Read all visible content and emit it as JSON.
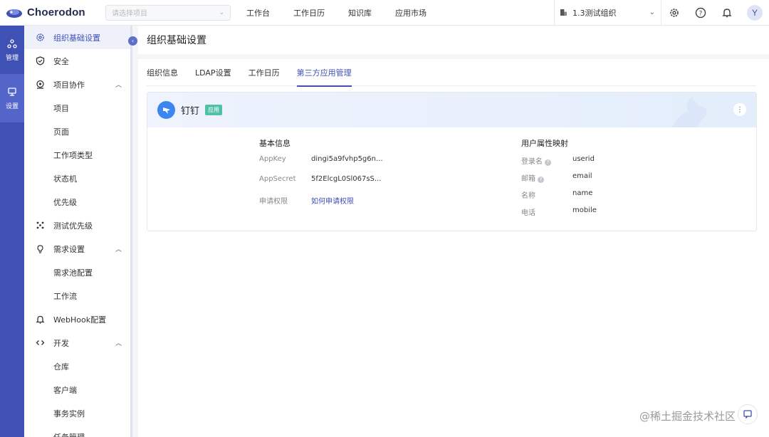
{
  "header": {
    "logo_text": "Choerodon",
    "project_select_placeholder": "请选择项目",
    "nav": [
      "工作台",
      "工作日历",
      "知识库",
      "应用市场"
    ],
    "org_select": "1.3测试组织",
    "avatar_letter": "Y"
  },
  "rail": {
    "items": [
      {
        "label": "管理"
      },
      {
        "label": "设置"
      }
    ]
  },
  "sidebar": {
    "items": [
      {
        "label": "组织基础设置",
        "icon": "gear-icon",
        "active": true
      },
      {
        "label": "安全",
        "icon": "shield-icon"
      },
      {
        "label": "项目协作",
        "icon": "collab-icon",
        "expanded": true
      },
      {
        "label": "项目",
        "sub": true
      },
      {
        "label": "页面",
        "sub": true
      },
      {
        "label": "工作项类型",
        "sub": true
      },
      {
        "label": "状态机",
        "sub": true
      },
      {
        "label": "优先级",
        "sub": true
      },
      {
        "label": "测试优先级",
        "icon": "grid-icon"
      },
      {
        "label": "需求设置",
        "icon": "bulb-icon",
        "expanded": true
      },
      {
        "label": "需求池配置",
        "sub": true
      },
      {
        "label": "工作流",
        "sub": true
      },
      {
        "label": "WebHook配置",
        "icon": "bell-icon"
      },
      {
        "label": "开发",
        "icon": "code-icon",
        "expanded": true
      },
      {
        "label": "仓库",
        "sub": true
      },
      {
        "label": "客户端",
        "sub": true
      },
      {
        "label": "事务实例",
        "sub": true
      },
      {
        "label": "任务管理",
        "sub": true
      }
    ]
  },
  "page": {
    "title": "组织基础设置",
    "tabs": [
      {
        "label": "组织信息"
      },
      {
        "label": "LDAP设置"
      },
      {
        "label": "工作日历"
      },
      {
        "label": "第三方应用管理",
        "active": true
      }
    ]
  },
  "app_card": {
    "name": "钉钉",
    "status": "应用",
    "basic_title": "基本信息",
    "basic": [
      {
        "label": "AppKey",
        "value": "dingi5a9fvhp5g6n..."
      },
      {
        "label": "AppSecret",
        "value": "5f2ElcgL0Sl067sS..."
      },
      {
        "label": "申请权限",
        "value": "如何申请权限",
        "link": true
      }
    ],
    "mapping_title": "用户属性映射",
    "mapping": [
      {
        "label": "登录名",
        "value": "userid",
        "help": true
      },
      {
        "label": "邮箱",
        "value": "email",
        "help": true
      },
      {
        "label": "名称",
        "value": "name"
      },
      {
        "label": "电话",
        "value": "mobile"
      }
    ]
  },
  "watermark": "@稀土掘金技术社区",
  "colors": {
    "primary": "#3f51b5",
    "rail": "#3f51b5",
    "badge": "#50c1a5",
    "app_logo": "#3b86f0"
  }
}
